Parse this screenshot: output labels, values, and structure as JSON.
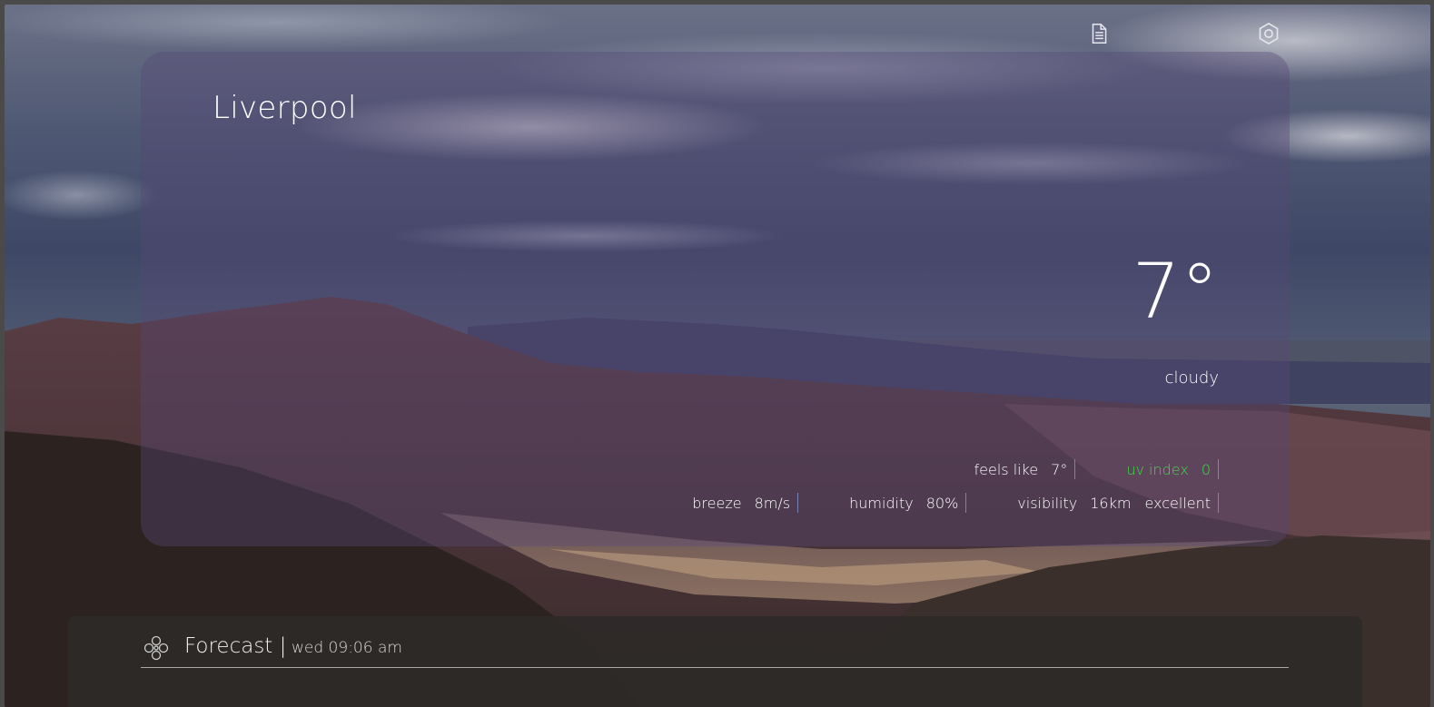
{
  "location": {
    "city": "Liverpool"
  },
  "current": {
    "temperature": "7°",
    "condition": "cloudy",
    "feels_like_label": "feels like",
    "feels_like_value": "7°",
    "uv_label": "uv index",
    "uv_value": "0",
    "breeze_label": "breeze",
    "breeze_value": "8m/s",
    "humidity_label": "humidity",
    "humidity_value": "80%",
    "visibility_label": "visibility",
    "visibility_value": "16km",
    "visibility_quality": "excellent"
  },
  "toolbar": {
    "icons": [
      "document-icon",
      "settings-gear-icon"
    ]
  },
  "forecast": {
    "title": "Forecast |",
    "time": "wed 09:06 am",
    "icon": "forecast-cluster-icon"
  },
  "colors": {
    "uv_accent": "#3edc45",
    "panel_tint": "#564676",
    "forecast_bg": "#2c2a28"
  }
}
